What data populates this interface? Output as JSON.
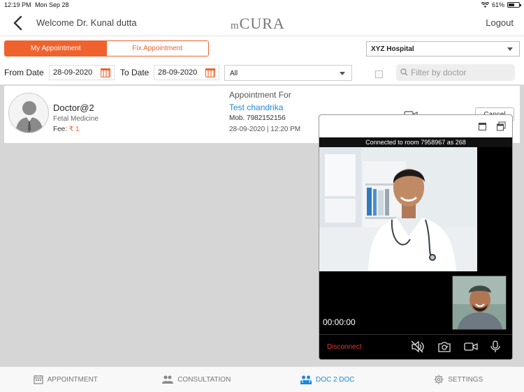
{
  "status": {
    "time": "12:19 PM",
    "date": "Mon Sep 28",
    "battery": "61%"
  },
  "header": {
    "welcome": "Welcome Dr. Kunal dutta",
    "logo_prefix": "m",
    "logo_main": "CURA",
    "logout": "Logout"
  },
  "tabs": {
    "my_appointment": "My Appointment",
    "fix_appointment": "Fix Appointment"
  },
  "hospital": {
    "selected": "XYZ Hospital"
  },
  "filters": {
    "from_label": "From Date",
    "from_value": "28-09-2020",
    "to_label": "To Date",
    "to_value": "28-09-2020",
    "type_value": "All",
    "search_placeholder": "Filter by doctor"
  },
  "appointment": {
    "doctor_name": "Doctor@2",
    "speciality": "Fetal Medicine",
    "fee_label": "Fee:",
    "fee_value": "₹ 1",
    "for_label": "Appointment For",
    "patient": "Test chandrika",
    "mobile": "Mob. 7982152156",
    "datetime": "28-09-2020 | 12:20 PM",
    "cancel": "Cancel"
  },
  "video": {
    "connected": "Connected to room 7958967 as 268",
    "timer": "00:00:00",
    "disconnect": "Disconnect"
  },
  "bottom_nav": {
    "items": [
      {
        "label": "APPOINTMENT",
        "icon": "calendar-icon"
      },
      {
        "label": "CONSULTATION",
        "icon": "people-icon"
      },
      {
        "label": "DOC 2 DOC",
        "icon": "doctors-icon"
      },
      {
        "label": "SETTINGS",
        "icon": "gear-icon"
      }
    ]
  },
  "colors": {
    "accent": "#f0622d",
    "link": "#1e88d8",
    "disconnect": "#e53935"
  }
}
